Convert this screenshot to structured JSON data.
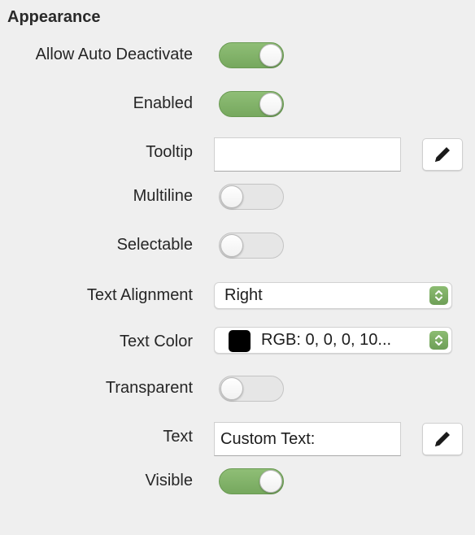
{
  "section": {
    "title": "Appearance"
  },
  "properties": {
    "allow_auto_deactivate": {
      "label": "Allow Auto Deactivate",
      "value": true
    },
    "enabled": {
      "label": "Enabled",
      "value": true
    },
    "tooltip": {
      "label": "Tooltip",
      "value": ""
    },
    "multiline": {
      "label": "Multiline",
      "value": false
    },
    "selectable": {
      "label": "Selectable",
      "value": false
    },
    "text_alignment": {
      "label": "Text Alignment",
      "value": "Right"
    },
    "text_color": {
      "label": "Text Color",
      "value": "RGB: 0, 0, 0, 10...",
      "swatch": "#000000"
    },
    "transparent": {
      "label": "Transparent",
      "value": false
    },
    "text": {
      "label": "Text",
      "value": "Custom Text:"
    },
    "visible": {
      "label": "Visible",
      "value": true
    }
  },
  "icons": {
    "edit": "pencil-icon",
    "popup": "up-down-chevron-icon"
  },
  "colors": {
    "toggle_on": "#80b066",
    "toggle_off": "#e6e6e6",
    "panel_bg": "#efefef"
  }
}
